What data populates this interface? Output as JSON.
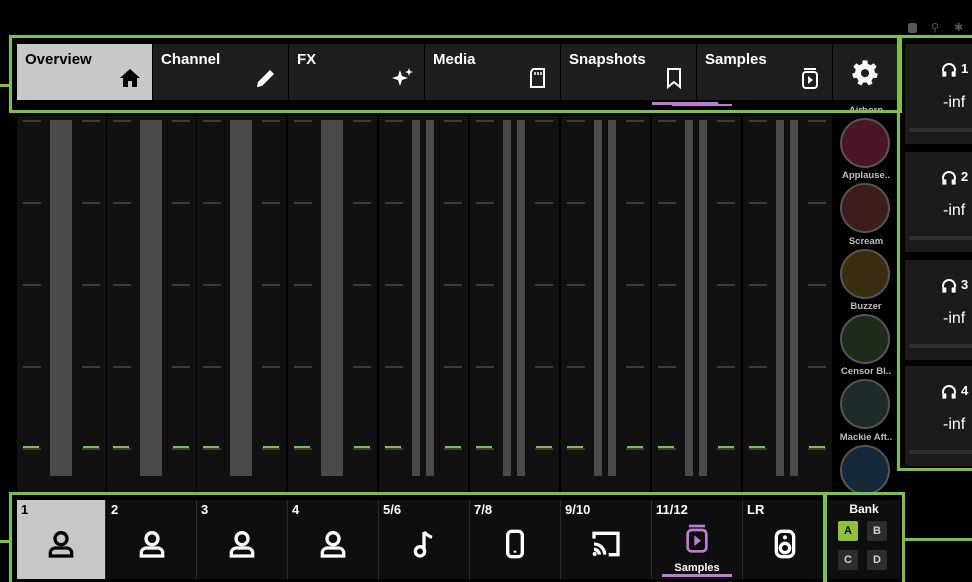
{
  "tabs": [
    {
      "label": "Overview",
      "icon": "home-icon",
      "active": true
    },
    {
      "label": "Channel",
      "icon": "pencil-icon",
      "active": false
    },
    {
      "label": "FX",
      "icon": "sparkle-icon",
      "active": false
    },
    {
      "label": "Media",
      "icon": "sd-card-icon",
      "active": false
    },
    {
      "label": "Snapshots",
      "icon": "bookmark-icon",
      "active": false
    },
    {
      "label": "Samples",
      "icon": "sample-player-icon",
      "active": false
    }
  ],
  "settings_icon": "gear-icon",
  "samples": [
    {
      "label": "Airhorn",
      "color": "#4a1626"
    },
    {
      "label": "Applause..",
      "color": "#3d1d1a"
    },
    {
      "label": "Scream",
      "color": "#3a2e12"
    },
    {
      "label": "Buzzer",
      "color": "#202a1b"
    },
    {
      "label": "Censor Bl..",
      "color": "#1f2a2a"
    },
    {
      "label": "Mackie Aft..",
      "color": "#16293a"
    }
  ],
  "headphones": [
    {
      "number": "1",
      "value": "-inf"
    },
    {
      "number": "2",
      "value": "-inf"
    },
    {
      "number": "3",
      "value": "-inf"
    },
    {
      "number": "4",
      "value": "-inf"
    }
  ],
  "channels": [
    {
      "label": "1",
      "icon": "person-icon",
      "active": true
    },
    {
      "label": "2",
      "icon": "person-icon"
    },
    {
      "label": "3",
      "icon": "person-icon"
    },
    {
      "label": "4",
      "icon": "person-icon"
    },
    {
      "label": "5/6",
      "icon": "music-note-icon"
    },
    {
      "label": "7/8",
      "icon": "phone-icon"
    },
    {
      "label": "9/10",
      "icon": "cast-icon"
    },
    {
      "label": "11/12",
      "icon": "sample-player-icon",
      "sublabel": "Samples"
    },
    {
      "label": "LR",
      "icon": "speaker-icon"
    }
  ],
  "bank": {
    "title": "Bank",
    "buttons": [
      {
        "label": "A",
        "active": true
      },
      {
        "label": "B"
      },
      {
        "label": "C"
      },
      {
        "label": "D"
      }
    ]
  },
  "colors": {
    "accent": "#7cc242",
    "samples_accent": "#c07ad8",
    "bank_active": "#8dc23a"
  }
}
